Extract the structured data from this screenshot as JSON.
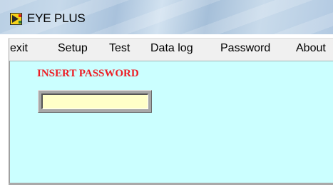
{
  "window": {
    "title": "EYE PLUS",
    "icon": "eye-plus-app-icon"
  },
  "menu": {
    "items": [
      {
        "label": "exit"
      },
      {
        "label": "Setup"
      },
      {
        "label": "Test"
      },
      {
        "label": "Data log"
      },
      {
        "label": "Password"
      },
      {
        "label": "About"
      }
    ]
  },
  "password_panel": {
    "label": "INSERT PASSWORD",
    "value": ""
  },
  "colors": {
    "client_background": "#cbffff",
    "label_color": "#ee1c24",
    "input_background": "#ffffc8",
    "menubar_background": "#f0f0f0"
  }
}
